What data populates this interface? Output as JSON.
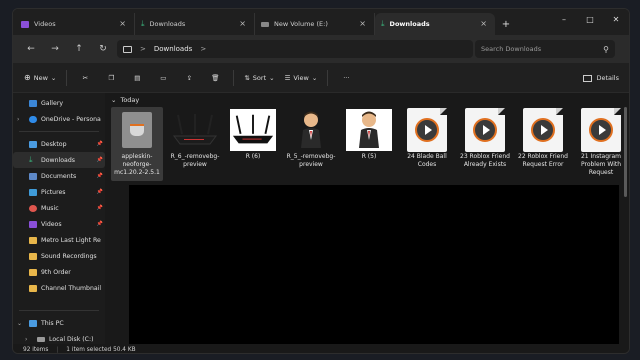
{
  "tabs": [
    {
      "label": "Videos",
      "active": false
    },
    {
      "label": "Downloads",
      "active": false
    },
    {
      "label": "New Volume (E:)",
      "active": false
    },
    {
      "label": "Downloads",
      "active": true
    }
  ],
  "tab_close": "×",
  "new_tab": "+",
  "window_controls": {
    "minimize": "–",
    "maximize": "□",
    "close": "✕"
  },
  "address": {
    "path_item": "Downloads",
    "chevron": ">",
    "search_placeholder": "Search Downloads"
  },
  "commands": {
    "new": "New",
    "sort": "Sort",
    "view": "View",
    "more": "···",
    "details": "Details"
  },
  "sidebar": {
    "items": [
      {
        "label": "Gallery",
        "icon": "gallery-icon",
        "pinned": false
      },
      {
        "label": "OneDrive - Persona",
        "icon": "cloud-icon",
        "pinned": false
      },
      {
        "label": "Desktop",
        "icon": "desktop-icon",
        "pinned": true
      },
      {
        "label": "Downloads",
        "icon": "download-icon",
        "pinned": true
      },
      {
        "label": "Documents",
        "icon": "document-icon",
        "pinned": true
      },
      {
        "label": "Pictures",
        "icon": "pictures-icon",
        "pinned": true
      },
      {
        "label": "Music",
        "icon": "music-icon",
        "pinned": true
      },
      {
        "label": "Videos",
        "icon": "videos-icon",
        "pinned": true
      },
      {
        "label": "Metro Last Light Re",
        "icon": "folder-icon",
        "pinned": false
      },
      {
        "label": "Sound Recordings",
        "icon": "folder-icon",
        "pinned": false
      },
      {
        "label": "9th Order",
        "icon": "folder-icon",
        "pinned": false
      },
      {
        "label": "Channel Thumbnail",
        "icon": "folder-icon",
        "pinned": false
      },
      {
        "label": "This PC",
        "icon": "pc-icon",
        "pinned": false
      },
      {
        "label": "Local Disk (C:)",
        "icon": "drive-icon",
        "pinned": false
      }
    ]
  },
  "group": {
    "label": "Today",
    "chevron": "⌄"
  },
  "files": [
    {
      "name": "appleskin-neoforge-mc1.20.2-2.5.1",
      "type": "jar"
    },
    {
      "name": "R_6_-removebg-preview",
      "type": "router"
    },
    {
      "name": "R (6)",
      "type": "router-white"
    },
    {
      "name": "R_5_-removebg-preview",
      "type": "person"
    },
    {
      "name": "R (5)",
      "type": "person-white"
    },
    {
      "name": "24 Blade Ball Codes",
      "type": "video"
    },
    {
      "name": "23 Roblox Friend Already Exists",
      "type": "video"
    },
    {
      "name": "22 Roblox Friend Request Error",
      "type": "video"
    },
    {
      "name": "21 Instagram Problem With Request",
      "type": "video"
    }
  ],
  "status": {
    "count": "92 items",
    "selected": "1 item selected  50.4 KB"
  }
}
